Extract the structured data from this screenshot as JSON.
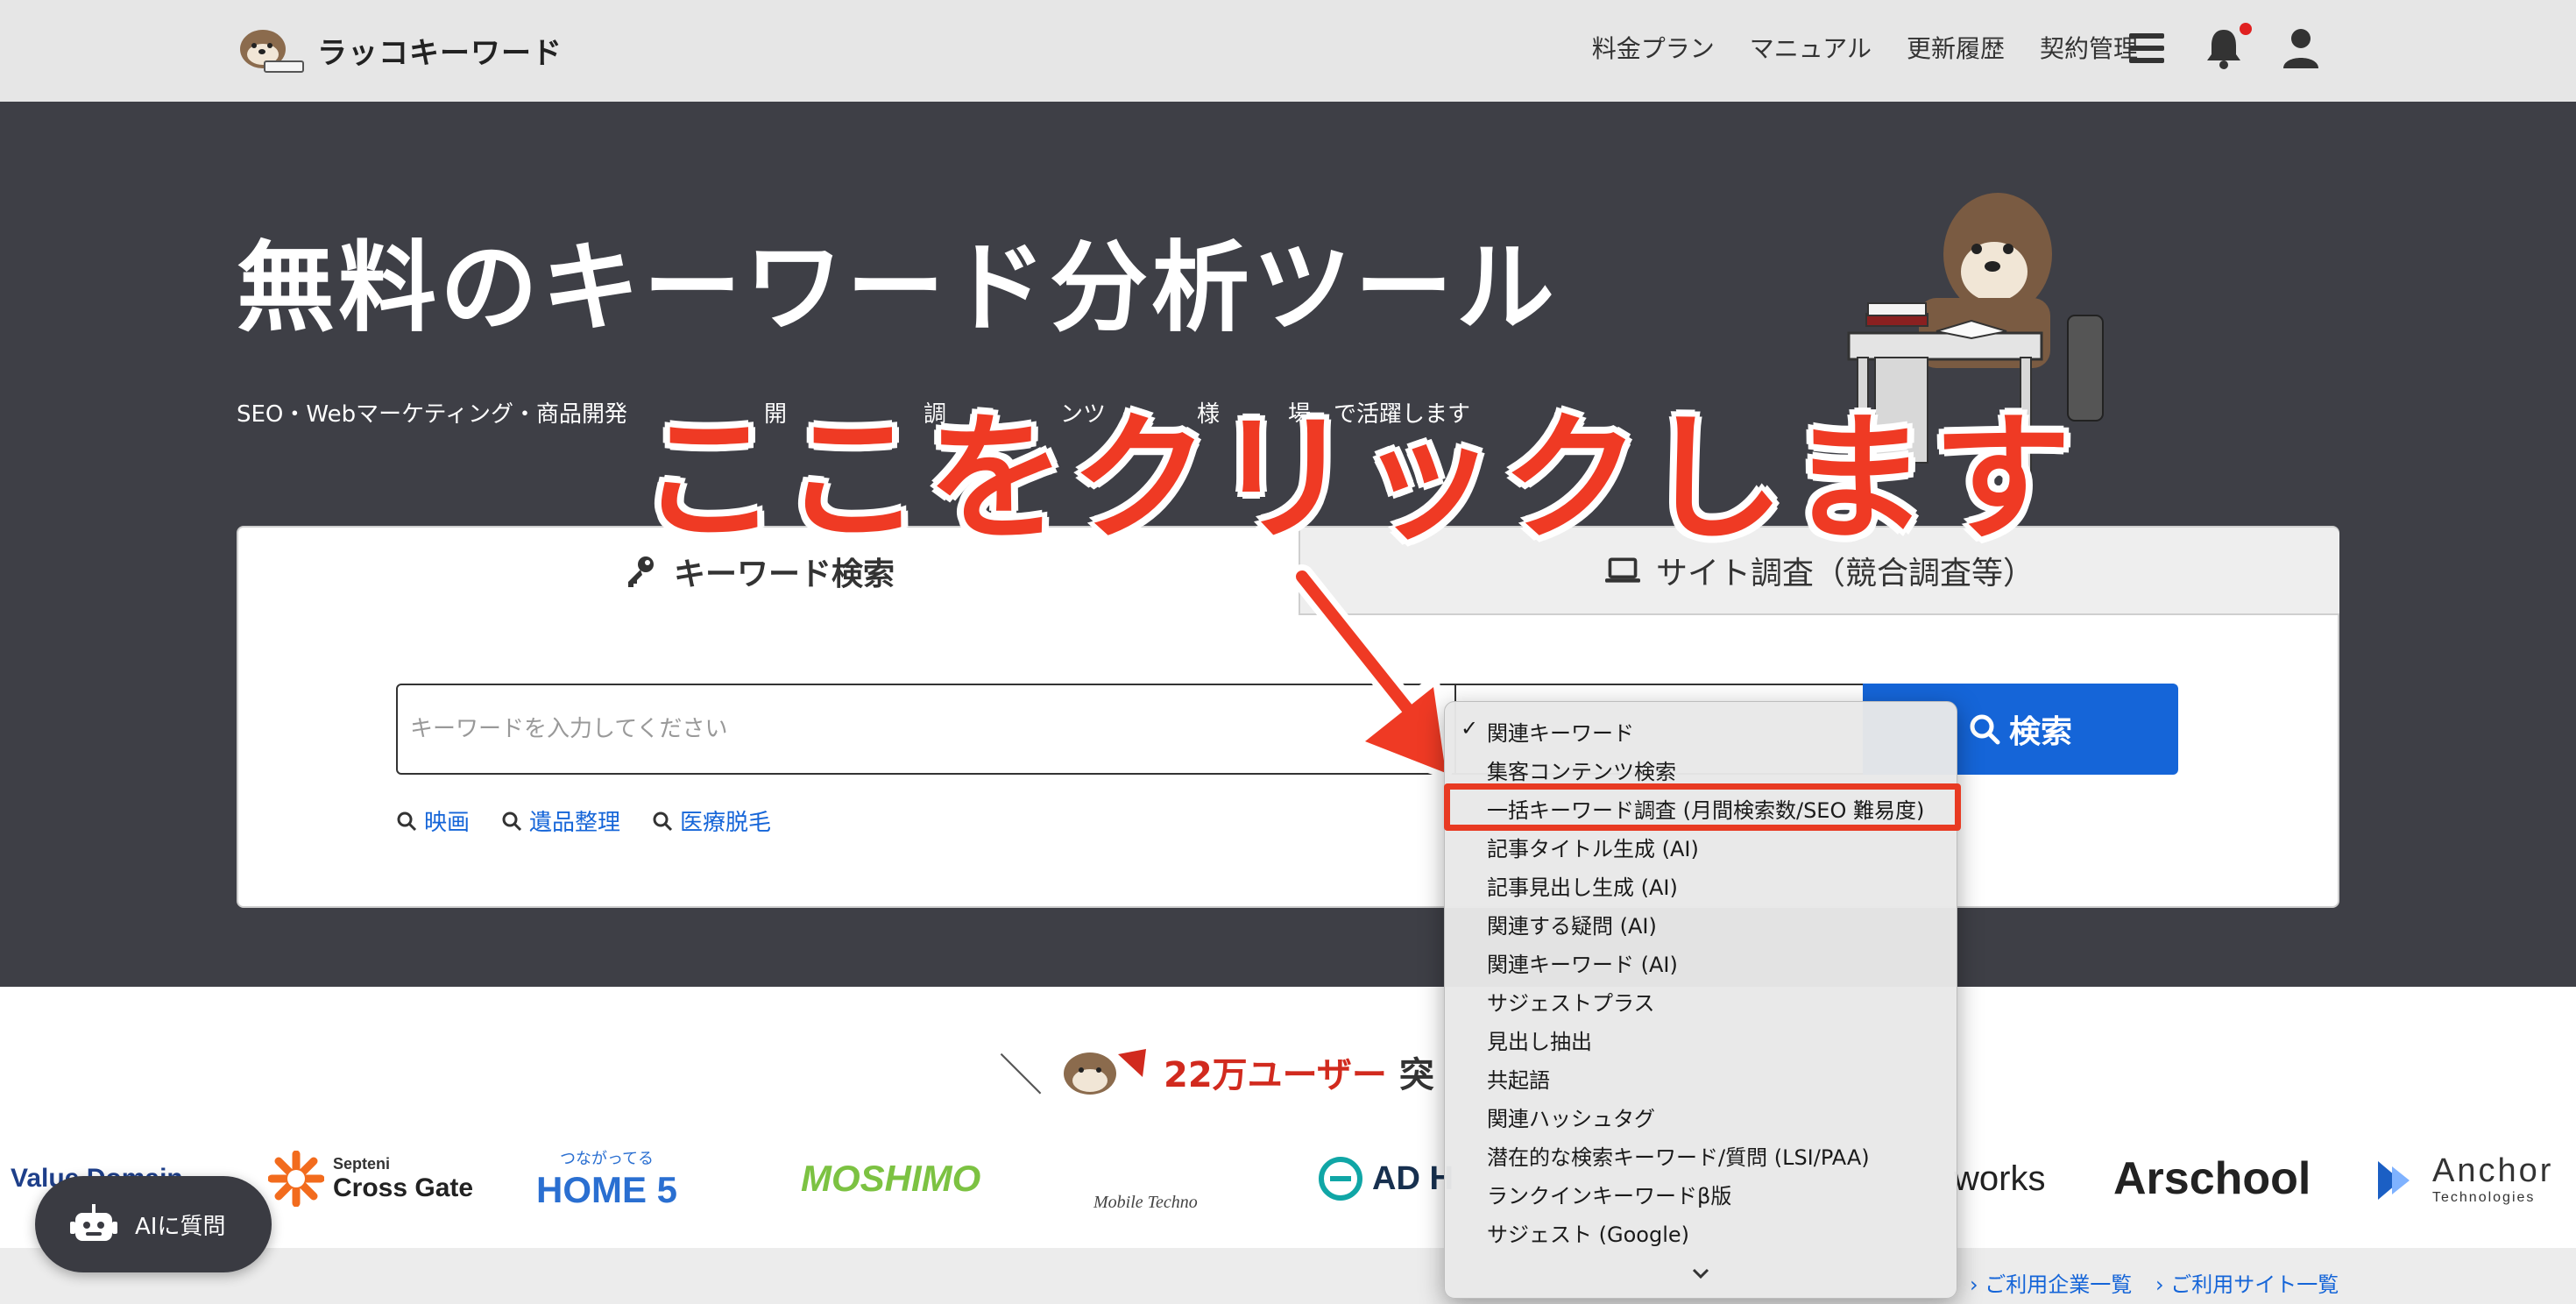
{
  "header": {
    "logo_text": "ラッコキーワード",
    "nav": [
      "料金プラン",
      "マニュアル",
      "更新履歴",
      "契約管理"
    ]
  },
  "hero": {
    "title": "無料のキーワード分析ツール",
    "subtitle": "SEO・Webマーケティング・商品開発　　　　　　開　　　　　　調　　　　　ンツ　　　　様　　　場　で活躍します"
  },
  "search": {
    "tab_keyword": "キーワード検索",
    "tab_site": "サイト調査（競合調査等）",
    "input_placeholder": "キーワードを入力してください",
    "button_label": "検索",
    "suggestions": [
      "映画",
      "遺品整理",
      "医療脱毛"
    ]
  },
  "dropdown": {
    "selected_index": 0,
    "highlighted_index": 2,
    "options": [
      "関連キーワード",
      "集客コンテンツ検索",
      "一括キーワード調査 (月間検索数/SEO 難易度)",
      "記事タイトル生成 (AI)",
      "記事見出し生成 (AI)",
      "関連する疑問 (AI)",
      "関連キーワード (AI)",
      "サジェストプラス",
      "見出し抽出",
      "共起語",
      "関連ハッシュタグ",
      "潜在的な検索キーワード/質問 (LSI/PAA)",
      "ランクインキーワードβ版",
      "サジェスト (Google)"
    ]
  },
  "annotation": {
    "callout": "ここをクリックします",
    "color": "#ef3a24"
  },
  "users": {
    "slash": "＼",
    "highlight": "22万ユーザー",
    "rest": "突"
  },
  "companies": [
    {
      "name": "Value Domain",
      "color": "#1e3f8a"
    },
    {
      "name_small": "Septeni",
      "name": "Cross Gate",
      "color": "#222222",
      "mark_color": "#f26b1d"
    },
    {
      "name_small": "つながってる",
      "name": "HOME 5",
      "color": "#2a6fd1"
    },
    {
      "name": "MOSHIMO",
      "color": "#7cc242"
    },
    {
      "name": "Mobile Techno",
      "color": "#444444"
    },
    {
      "name": "AD H",
      "color": "#17304f",
      "mark_color": "#10a6a6"
    },
    {
      "name": "works",
      "color": "#222222"
    },
    {
      "name": "Arschool",
      "color": "#222222"
    },
    {
      "name": "Anchor",
      "name_small": "Technologies",
      "color": "#333333",
      "mark_color": "#1b5fc4"
    }
  ],
  "footer_links": [
    "ご利用企業一覧",
    "ご利用サイト一覧"
  ],
  "ai_button": {
    "label": "AIに質問"
  },
  "colors": {
    "header_bg": "#e6e6e6",
    "hero_bg": "#3e3f46",
    "primary_blue": "#1565d8",
    "accent_red": "#e83a22"
  }
}
